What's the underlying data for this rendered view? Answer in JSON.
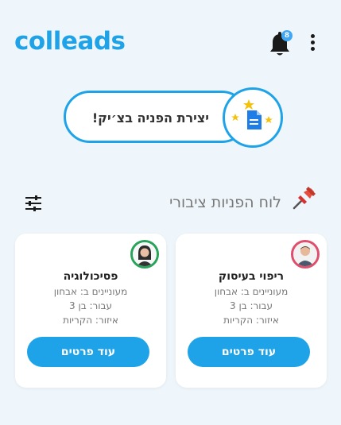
{
  "header": {
    "logo_text": "colleads",
    "notification_count": "8"
  },
  "create_request": {
    "label": "יצירת הפניה בצ׳יק!"
  },
  "board": {
    "title": "לוח הפניות ציבורי"
  },
  "cards": [
    {
      "title": "ריפוי בעיסוק",
      "interested": "מעוניינים ב: אבחון",
      "for": "עבור: בן 3",
      "area": "איזור: הקריות",
      "button": "עוד פרטים"
    },
    {
      "title": "פסיכולוגיה",
      "interested": "מעוניינים ב: אבחון",
      "for": "עבור: בן 3",
      "area": "איזור: הקריות",
      "button": "עוד פרטים"
    }
  ],
  "colors": {
    "brand": "#1fa3e8",
    "background": "#eef6fb",
    "avatar_ring_1": "#e04e6d",
    "avatar_ring_2": "#27a35a"
  }
}
